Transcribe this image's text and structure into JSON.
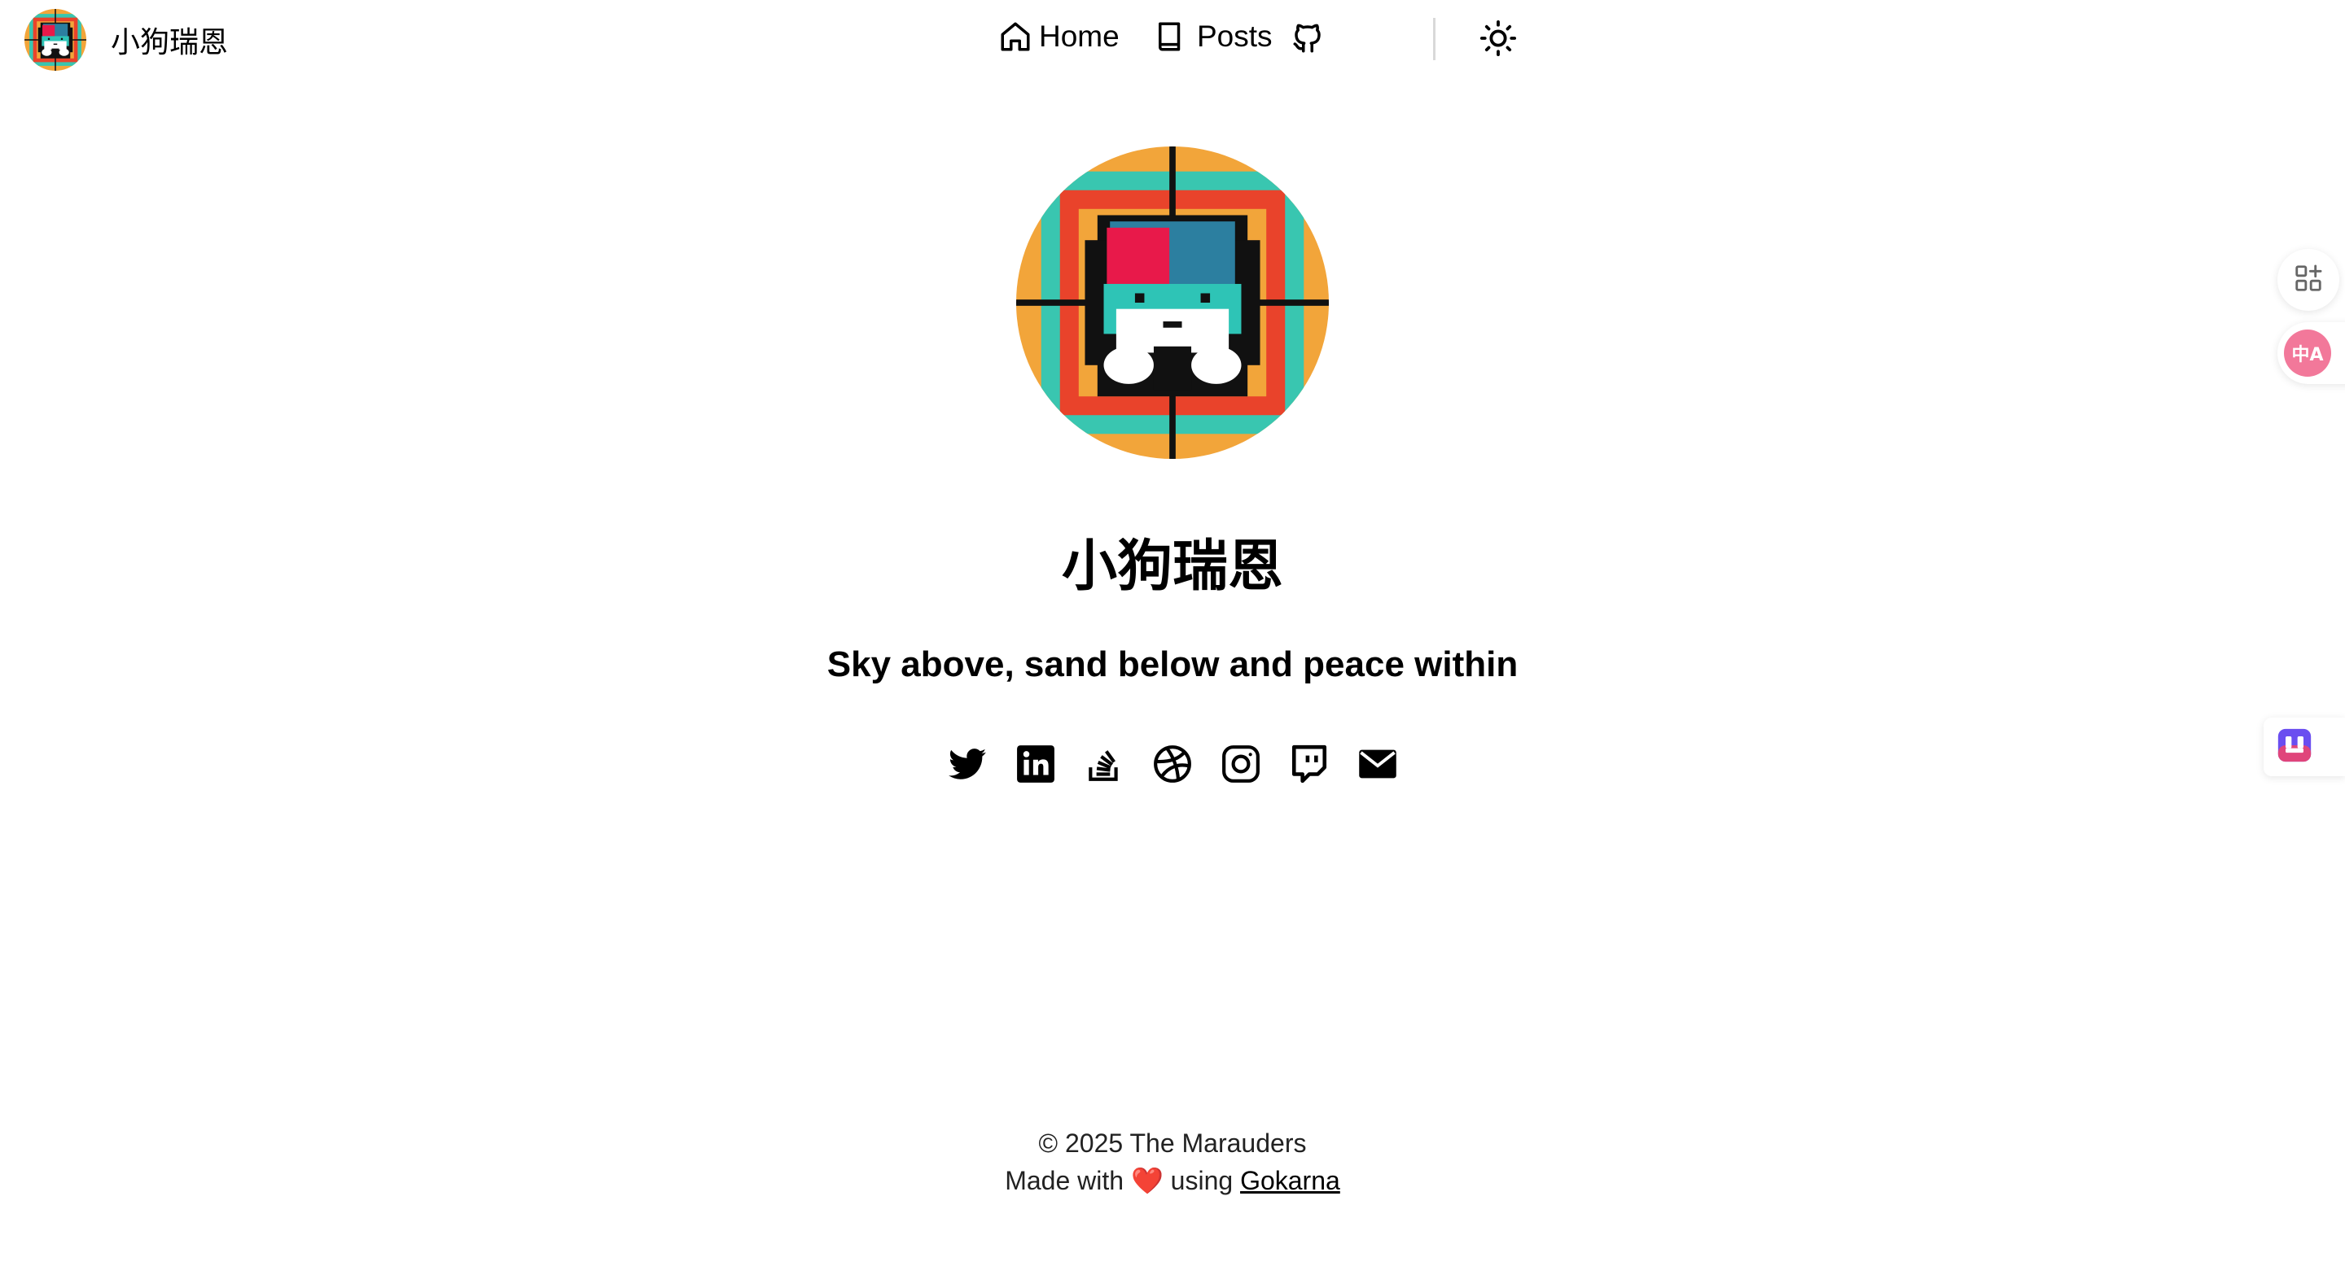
{
  "header": {
    "site_title": "小狗瑞恩",
    "nav": [
      {
        "label": "Home",
        "icon": "home-icon"
      },
      {
        "label": "Posts",
        "icon": "book-icon"
      },
      {
        "label": "",
        "icon": "github-icon"
      },
      {
        "label": "",
        "icon": "sun-icon"
      }
    ]
  },
  "profile": {
    "name": "小狗瑞恩",
    "tagline": "Sky above, sand below and peace within"
  },
  "social": [
    {
      "icon": "twitter-icon"
    },
    {
      "icon": "linkedin-icon"
    },
    {
      "icon": "stackoverflow-icon"
    },
    {
      "icon": "dribbble-icon"
    },
    {
      "icon": "instagram-icon"
    },
    {
      "icon": "twitch-icon"
    },
    {
      "icon": "mail-icon"
    }
  ],
  "footer": {
    "copyright": "© 2025 The Marauders",
    "made_with": "Made with",
    "heart": "❤️",
    "using": "using",
    "theme_link": "Gokarna"
  },
  "floating": {
    "translate_label": "中A",
    "apps_icon": "apps-sparkle-icon",
    "tool_icon": "toolbox-icon"
  },
  "colors": {
    "background": "#ffffff",
    "text": "#000000",
    "divider": "#d9d9d9",
    "translate_accent": "#f2789a",
    "tool_accent": "#6a4ef0",
    "heart": "#e0001b"
  }
}
